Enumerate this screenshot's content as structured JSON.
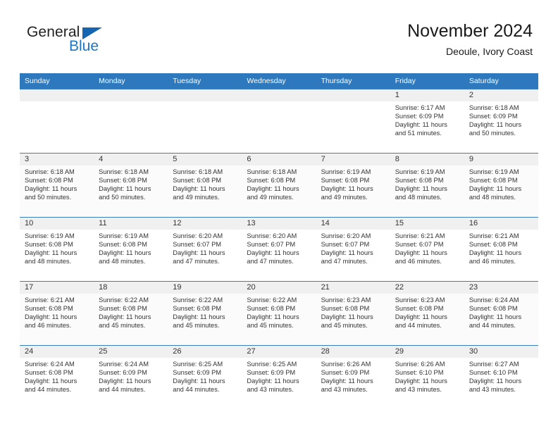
{
  "brand": {
    "word1": "General",
    "word2": "Blue",
    "triangle_color": "#1565b0",
    "blue_color": "#1d76c4"
  },
  "header": {
    "month_title": "November 2024",
    "location": "Deoule, Ivory Coast"
  },
  "theme": {
    "header_bg": "#2e79bd",
    "header_text": "#ffffff",
    "daynum_band": "#f0f0f0",
    "row_border": "#3a7cbd",
    "stripe_bg": "#fbfbfb"
  },
  "weekdays": [
    "Sunday",
    "Monday",
    "Tuesday",
    "Wednesday",
    "Thursday",
    "Friday",
    "Saturday"
  ],
  "labels": {
    "sunrise_prefix": "Sunrise:",
    "sunset_prefix": "Sunset:",
    "daylight_prefix": "Daylight:"
  },
  "weeks": [
    [
      {
        "day": "",
        "empty": true
      },
      {
        "day": "",
        "empty": true
      },
      {
        "day": "",
        "empty": true
      },
      {
        "day": "",
        "empty": true
      },
      {
        "day": "",
        "empty": true
      },
      {
        "day": "1",
        "sunrise": "Sunrise: 6:17 AM",
        "sunset": "Sunset: 6:09 PM",
        "daylight1": "Daylight: 11 hours",
        "daylight2": "and 51 minutes."
      },
      {
        "day": "2",
        "sunrise": "Sunrise: 6:18 AM",
        "sunset": "Sunset: 6:09 PM",
        "daylight1": "Daylight: 11 hours",
        "daylight2": "and 50 minutes."
      }
    ],
    [
      {
        "day": "3",
        "sunrise": "Sunrise: 6:18 AM",
        "sunset": "Sunset: 6:08 PM",
        "daylight1": "Daylight: 11 hours",
        "daylight2": "and 50 minutes."
      },
      {
        "day": "4",
        "sunrise": "Sunrise: 6:18 AM",
        "sunset": "Sunset: 6:08 PM",
        "daylight1": "Daylight: 11 hours",
        "daylight2": "and 50 minutes."
      },
      {
        "day": "5",
        "sunrise": "Sunrise: 6:18 AM",
        "sunset": "Sunset: 6:08 PM",
        "daylight1": "Daylight: 11 hours",
        "daylight2": "and 49 minutes."
      },
      {
        "day": "6",
        "sunrise": "Sunrise: 6:18 AM",
        "sunset": "Sunset: 6:08 PM",
        "daylight1": "Daylight: 11 hours",
        "daylight2": "and 49 minutes."
      },
      {
        "day": "7",
        "sunrise": "Sunrise: 6:19 AM",
        "sunset": "Sunset: 6:08 PM",
        "daylight1": "Daylight: 11 hours",
        "daylight2": "and 49 minutes."
      },
      {
        "day": "8",
        "sunrise": "Sunrise: 6:19 AM",
        "sunset": "Sunset: 6:08 PM",
        "daylight1": "Daylight: 11 hours",
        "daylight2": "and 48 minutes."
      },
      {
        "day": "9",
        "sunrise": "Sunrise: 6:19 AM",
        "sunset": "Sunset: 6:08 PM",
        "daylight1": "Daylight: 11 hours",
        "daylight2": "and 48 minutes."
      }
    ],
    [
      {
        "day": "10",
        "sunrise": "Sunrise: 6:19 AM",
        "sunset": "Sunset: 6:08 PM",
        "daylight1": "Daylight: 11 hours",
        "daylight2": "and 48 minutes."
      },
      {
        "day": "11",
        "sunrise": "Sunrise: 6:19 AM",
        "sunset": "Sunset: 6:08 PM",
        "daylight1": "Daylight: 11 hours",
        "daylight2": "and 48 minutes."
      },
      {
        "day": "12",
        "sunrise": "Sunrise: 6:20 AM",
        "sunset": "Sunset: 6:07 PM",
        "daylight1": "Daylight: 11 hours",
        "daylight2": "and 47 minutes."
      },
      {
        "day": "13",
        "sunrise": "Sunrise: 6:20 AM",
        "sunset": "Sunset: 6:07 PM",
        "daylight1": "Daylight: 11 hours",
        "daylight2": "and 47 minutes."
      },
      {
        "day": "14",
        "sunrise": "Sunrise: 6:20 AM",
        "sunset": "Sunset: 6:07 PM",
        "daylight1": "Daylight: 11 hours",
        "daylight2": "and 47 minutes."
      },
      {
        "day": "15",
        "sunrise": "Sunrise: 6:21 AM",
        "sunset": "Sunset: 6:07 PM",
        "daylight1": "Daylight: 11 hours",
        "daylight2": "and 46 minutes."
      },
      {
        "day": "16",
        "sunrise": "Sunrise: 6:21 AM",
        "sunset": "Sunset: 6:08 PM",
        "daylight1": "Daylight: 11 hours",
        "daylight2": "and 46 minutes."
      }
    ],
    [
      {
        "day": "17",
        "sunrise": "Sunrise: 6:21 AM",
        "sunset": "Sunset: 6:08 PM",
        "daylight1": "Daylight: 11 hours",
        "daylight2": "and 46 minutes."
      },
      {
        "day": "18",
        "sunrise": "Sunrise: 6:22 AM",
        "sunset": "Sunset: 6:08 PM",
        "daylight1": "Daylight: 11 hours",
        "daylight2": "and 45 minutes."
      },
      {
        "day": "19",
        "sunrise": "Sunrise: 6:22 AM",
        "sunset": "Sunset: 6:08 PM",
        "daylight1": "Daylight: 11 hours",
        "daylight2": "and 45 minutes."
      },
      {
        "day": "20",
        "sunrise": "Sunrise: 6:22 AM",
        "sunset": "Sunset: 6:08 PM",
        "daylight1": "Daylight: 11 hours",
        "daylight2": "and 45 minutes."
      },
      {
        "day": "21",
        "sunrise": "Sunrise: 6:23 AM",
        "sunset": "Sunset: 6:08 PM",
        "daylight1": "Daylight: 11 hours",
        "daylight2": "and 45 minutes."
      },
      {
        "day": "22",
        "sunrise": "Sunrise: 6:23 AM",
        "sunset": "Sunset: 6:08 PM",
        "daylight1": "Daylight: 11 hours",
        "daylight2": "and 44 minutes."
      },
      {
        "day": "23",
        "sunrise": "Sunrise: 6:24 AM",
        "sunset": "Sunset: 6:08 PM",
        "daylight1": "Daylight: 11 hours",
        "daylight2": "and 44 minutes."
      }
    ],
    [
      {
        "day": "24",
        "sunrise": "Sunrise: 6:24 AM",
        "sunset": "Sunset: 6:08 PM",
        "daylight1": "Daylight: 11 hours",
        "daylight2": "and 44 minutes."
      },
      {
        "day": "25",
        "sunrise": "Sunrise: 6:24 AM",
        "sunset": "Sunset: 6:09 PM",
        "daylight1": "Daylight: 11 hours",
        "daylight2": "and 44 minutes."
      },
      {
        "day": "26",
        "sunrise": "Sunrise: 6:25 AM",
        "sunset": "Sunset: 6:09 PM",
        "daylight1": "Daylight: 11 hours",
        "daylight2": "and 44 minutes."
      },
      {
        "day": "27",
        "sunrise": "Sunrise: 6:25 AM",
        "sunset": "Sunset: 6:09 PM",
        "daylight1": "Daylight: 11 hours",
        "daylight2": "and 43 minutes."
      },
      {
        "day": "28",
        "sunrise": "Sunrise: 6:26 AM",
        "sunset": "Sunset: 6:09 PM",
        "daylight1": "Daylight: 11 hours",
        "daylight2": "and 43 minutes."
      },
      {
        "day": "29",
        "sunrise": "Sunrise: 6:26 AM",
        "sunset": "Sunset: 6:10 PM",
        "daylight1": "Daylight: 11 hours",
        "daylight2": "and 43 minutes."
      },
      {
        "day": "30",
        "sunrise": "Sunrise: 6:27 AM",
        "sunset": "Sunset: 6:10 PM",
        "daylight1": "Daylight: 11 hours",
        "daylight2": "and 43 minutes."
      }
    ]
  ]
}
